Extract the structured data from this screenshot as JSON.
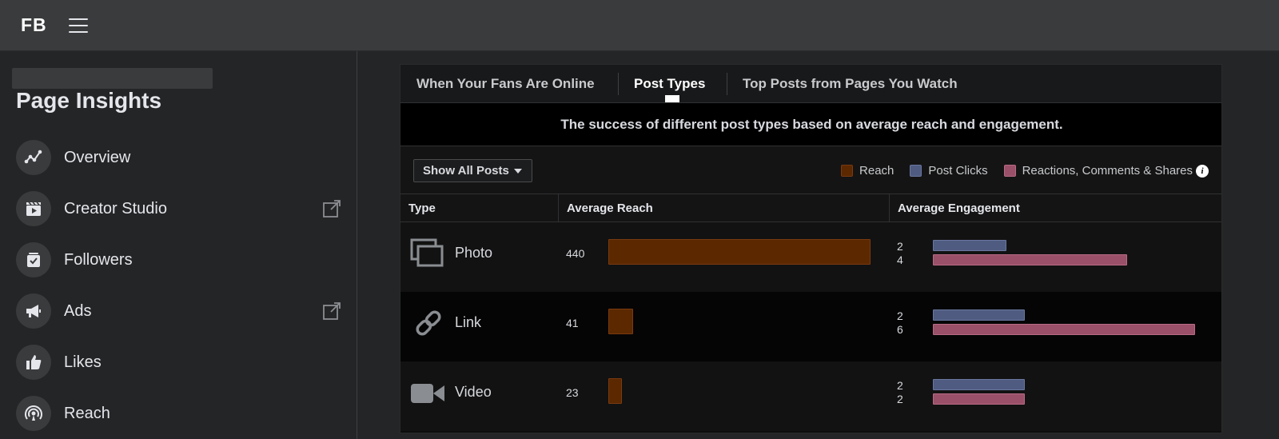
{
  "app": {
    "brand": "FB"
  },
  "sidebar": {
    "title": "Page Insights",
    "items": [
      {
        "label": "Overview",
        "icon": "overview-icon",
        "external": false
      },
      {
        "label": "Creator Studio",
        "icon": "creator-studio-icon",
        "external": true
      },
      {
        "label": "Followers",
        "icon": "followers-icon",
        "external": false
      },
      {
        "label": "Ads",
        "icon": "megaphone-icon",
        "external": true
      },
      {
        "label": "Likes",
        "icon": "thumbs-up-icon",
        "external": false
      },
      {
        "label": "Reach",
        "icon": "reach-icon",
        "external": false
      }
    ]
  },
  "tabs": [
    {
      "label": "When Your Fans Are Online",
      "active": false
    },
    {
      "label": "Post Types",
      "active": true
    },
    {
      "label": "Top Posts from Pages You Watch",
      "active": false
    }
  ],
  "subtitle": "The success of different post types based on average reach and engagement.",
  "filter": {
    "label": "Show All Posts"
  },
  "legend": [
    {
      "label": "Reach",
      "color": "#5b2800"
    },
    {
      "label": "Post Clicks",
      "color": "#4f5b80"
    },
    {
      "label": "Reactions, Comments & Shares",
      "color": "#9a5068"
    }
  ],
  "table": {
    "headers": {
      "type": "Type",
      "reach": "Average Reach",
      "engagement": "Average Engagement"
    },
    "rows": [
      {
        "type": "Photo",
        "icon": "photo-icon",
        "reach": "440",
        "reach_value": 440,
        "clicks": "2",
        "clicks_fill": 0.28,
        "reactions": "4",
        "reactions_fill": 0.74
      },
      {
        "type": "Link",
        "icon": "link-icon",
        "reach": "41",
        "reach_value": 41,
        "clicks": "2",
        "clicks_fill": 0.35,
        "reactions": "6",
        "reactions_fill": 1.0
      },
      {
        "type": "Video",
        "icon": "video-icon",
        "reach": "23",
        "reach_value": 23,
        "clicks": "2",
        "clicks_fill": 0.35,
        "reactions": "2",
        "reactions_fill": 0.35
      }
    ]
  }
}
